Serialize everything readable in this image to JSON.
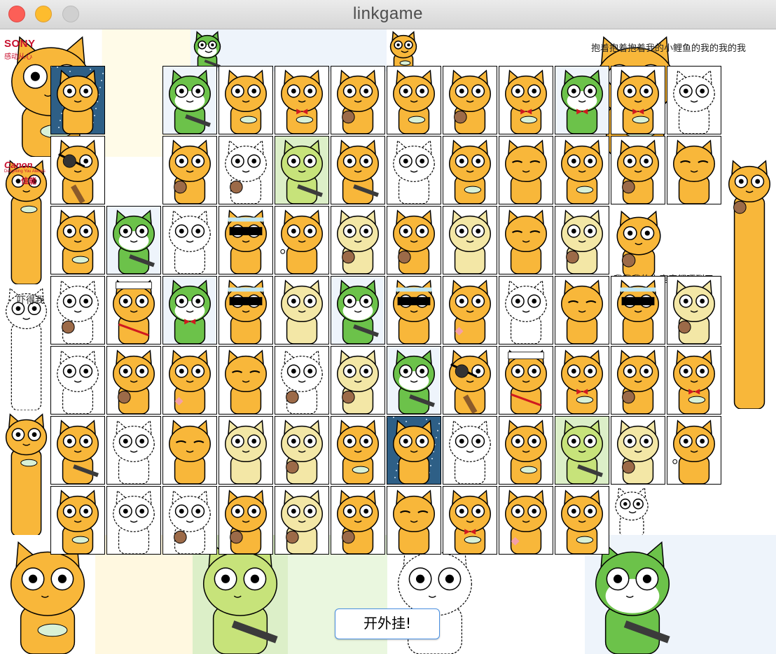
{
  "window": {
    "title": "linkgame"
  },
  "actions": {
    "cheat_label": "开外挂!"
  },
  "background_text": {
    "sony": "SONY",
    "sony_slogan": "感动从心",
    "canon": "Canon",
    "canon_slogan": "Delighting You Always",
    "canon_cn": "佳能",
    "top_right": "抱着抱着抱着我的小鲤鱼的我的我的我",
    "mid_right": "我我我的小鹿鹿都吓到了",
    "left_mid": "吓得我"
  },
  "palette": {
    "orange": "#f8b73a",
    "yellow": "#f7d04a",
    "green": "#6cc24a",
    "line": "#ffffff",
    "pale": "#f3e7a6",
    "lime": "#c7e37a"
  },
  "board": {
    "rows": [
      [
        "cat-night",
        "",
        "cat-green-gun",
        "cat-fish",
        "cat-fish-bow",
        "cat-teddy",
        "cat-fish",
        "cat-teddy",
        "cat-fish-bow",
        "cat-green-bow",
        "cat-fish-bow",
        "cat-line"
      ],
      [
        "cat-eyepatch-guitar",
        "",
        "cat-teddy",
        "cat-line-teddy",
        "cat-lime-gun",
        "cat-gun",
        "cat-line",
        "cat-fish",
        "cat-sleepy",
        "cat-fish",
        "cat-teddy",
        "cat-sleepy"
      ],
      [
        "cat-fish",
        "cat-green-gun",
        "cat-line",
        "cat-sunglasses",
        "cat-sparkle",
        "cat-pale-teddy",
        "cat-teddy",
        "cat-pale",
        "cat-sleepy",
        "cat-pale-teddy",
        "",
        ""
      ],
      [
        "cat-line-teddy",
        "cat-sign",
        "cat-green-bow",
        "cat-sunglasses",
        "cat-guitar-pale",
        "cat-green-gun",
        "cat-sunglasses",
        "cat-heart",
        "cat-line",
        "cat-sleepy",
        "cat-sunglasses",
        "cat-pale-teddy"
      ],
      [
        "cat-line",
        "cat-teddy",
        "cat-heart",
        "cat-sleepy",
        "cat-line-teddy",
        "cat-pale-teddy",
        "cat-green-gun",
        "cat-eyepatch-guitar",
        "cat-sign",
        "cat-fish-bow",
        "cat-teddy",
        "cat-fish-bow"
      ],
      [
        "cat-gun",
        "cat-line",
        "cat-sleepy",
        "cat-guitar-pale",
        "cat-pale-teddy",
        "cat-fish",
        "cat-night",
        "cat-line",
        "cat-fish",
        "cat-lime-gun",
        "cat-pale-teddy",
        "cat-sparkle"
      ],
      [
        "cat-fish",
        "cat-line",
        "cat-line-teddy",
        "cat-teddy",
        "cat-pale-teddy",
        "cat-teddy",
        "cat-sleepy",
        "cat-fish-bow",
        "cat-heart",
        "cat-fish",
        "",
        ""
      ]
    ]
  }
}
